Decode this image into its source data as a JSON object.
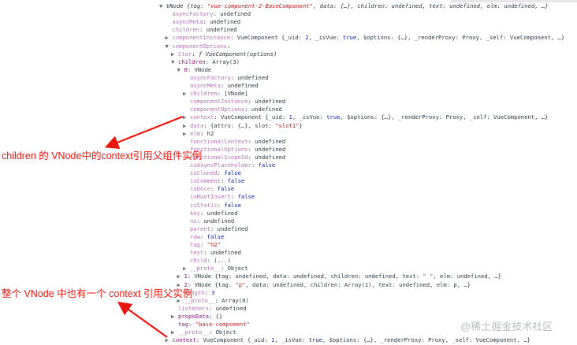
{
  "lines": [
    {
      "indent": 0,
      "arrow": "▼",
      "parts": [
        {
          "t": "VNode ",
          "c": "i"
        },
        {
          "t": "{tag: ",
          "c": "i"
        },
        {
          "t": "\"vue-component-2-BaseComponent\"",
          "c": "s i"
        },
        {
          "t": ", data: {…}, children: undefined, text: undefined, elm: undefined, …}",
          "c": "i"
        }
      ]
    },
    {
      "indent": 1,
      "arrow": "",
      "parts": [
        {
          "t": "asyncFactory",
          "c": "kd"
        },
        {
          "t": ": undefined",
          "c": ""
        }
      ]
    },
    {
      "indent": 1,
      "arrow": "",
      "parts": [
        {
          "t": "asyncMeta",
          "c": "kd"
        },
        {
          "t": ": undefined",
          "c": ""
        }
      ]
    },
    {
      "indent": 1,
      "arrow": "",
      "parts": [
        {
          "t": "children",
          "c": "kd"
        },
        {
          "t": ": undefined",
          "c": ""
        }
      ]
    },
    {
      "indent": 1,
      "arrow": "▶",
      "parts": [
        {
          "t": "componentInstance",
          "c": "kd"
        },
        {
          "t": ": VueComponent {_uid: ",
          "c": ""
        },
        {
          "t": "2",
          "c": "n"
        },
        {
          "t": ", _isVue: ",
          "c": ""
        },
        {
          "t": "true",
          "c": "kw"
        },
        {
          "t": ", $options: {…}, _renderProxy: Proxy, _self: VueComponent, …}",
          "c": ""
        }
      ]
    },
    {
      "indent": 1,
      "arrow": "▼",
      "parts": [
        {
          "t": "componentOptions",
          "c": "kd"
        },
        {
          "t": ":",
          "c": ""
        }
      ]
    },
    {
      "indent": 2,
      "arrow": "▶",
      "parts": [
        {
          "t": "Ctor",
          "c": "kd"
        },
        {
          "t": ": ",
          "c": ""
        },
        {
          "t": "ƒ VueComponent(options)",
          "c": "i"
        }
      ]
    },
    {
      "indent": 2,
      "arrow": "▼",
      "parts": [
        {
          "t": "children",
          "c": "k"
        },
        {
          "t": ": Array(3)",
          "c": ""
        }
      ]
    },
    {
      "indent": 3,
      "arrow": "▼",
      "parts": [
        {
          "t": "0",
          "c": "k"
        },
        {
          "t": ": VNode",
          "c": ""
        }
      ]
    },
    {
      "indent": 4,
      "arrow": "",
      "parts": [
        {
          "t": "asyncFactory",
          "c": "kd"
        },
        {
          "t": ": undefined",
          "c": ""
        }
      ]
    },
    {
      "indent": 4,
      "arrow": "",
      "parts": [
        {
          "t": "asyncMeta",
          "c": "kd"
        },
        {
          "t": ": undefined",
          "c": ""
        }
      ]
    },
    {
      "indent": 4,
      "arrow": "▶",
      "parts": [
        {
          "t": "children",
          "c": "kd"
        },
        {
          "t": ": [VNode]",
          "c": ""
        }
      ]
    },
    {
      "indent": 4,
      "arrow": "",
      "parts": [
        {
          "t": "componentInstance",
          "c": "kd"
        },
        {
          "t": ": undefined",
          "c": ""
        }
      ]
    },
    {
      "indent": 4,
      "arrow": "",
      "parts": [
        {
          "t": "componentOptions",
          "c": "kd"
        },
        {
          "t": ": undefined",
          "c": ""
        }
      ]
    },
    {
      "indent": 4,
      "arrow": "▶",
      "parts": [
        {
          "t": "context",
          "c": "kd"
        },
        {
          "t": ": VueComponent {_uid: ",
          "c": ""
        },
        {
          "t": "1",
          "c": "n"
        },
        {
          "t": ", _isVue: ",
          "c": ""
        },
        {
          "t": "true",
          "c": "kw"
        },
        {
          "t": ", $options: {…}, _renderProxy: Proxy, _self: VueComponent, …}",
          "c": ""
        }
      ]
    },
    {
      "indent": 4,
      "arrow": "▶",
      "parts": [
        {
          "t": "data",
          "c": "kd"
        },
        {
          "t": ": {attrs: {…}, slot: ",
          "c": ""
        },
        {
          "t": "\"slot1\"",
          "c": "s"
        },
        {
          "t": "}",
          "c": ""
        }
      ]
    },
    {
      "indent": 4,
      "arrow": "▶",
      "parts": [
        {
          "t": "elm",
          "c": "kd"
        },
        {
          "t": ": h2",
          "c": ""
        }
      ]
    },
    {
      "indent": 4,
      "arrow": "",
      "parts": [
        {
          "t": "functionalContext",
          "c": "kd"
        },
        {
          "t": ": undefined",
          "c": ""
        }
      ]
    },
    {
      "indent": 4,
      "arrow": "",
      "parts": [
        {
          "t": "functionalOptions",
          "c": "kd"
        },
        {
          "t": ": undefined",
          "c": ""
        }
      ]
    },
    {
      "indent": 4,
      "arrow": "",
      "parts": [
        {
          "t": "functionalScopeId",
          "c": "kd"
        },
        {
          "t": ": undefined",
          "c": ""
        }
      ]
    },
    {
      "indent": 4,
      "arrow": "",
      "parts": [
        {
          "t": "isAsyncPlaceholder",
          "c": "kd"
        },
        {
          "t": ": ",
          "c": ""
        },
        {
          "t": "false",
          "c": "kw"
        }
      ]
    },
    {
      "indent": 4,
      "arrow": "",
      "parts": [
        {
          "t": "isCloned",
          "c": "kd"
        },
        {
          "t": ": ",
          "c": ""
        },
        {
          "t": "false",
          "c": "kw"
        }
      ]
    },
    {
      "indent": 4,
      "arrow": "",
      "parts": [
        {
          "t": "isComment",
          "c": "kd"
        },
        {
          "t": ": ",
          "c": ""
        },
        {
          "t": "false",
          "c": "kw"
        }
      ]
    },
    {
      "indent": 4,
      "arrow": "",
      "parts": [
        {
          "t": "isOnce",
          "c": "kd"
        },
        {
          "t": ": ",
          "c": ""
        },
        {
          "t": "false",
          "c": "kw"
        }
      ]
    },
    {
      "indent": 4,
      "arrow": "",
      "parts": [
        {
          "t": "isRootInsert",
          "c": "kd"
        },
        {
          "t": ": ",
          "c": ""
        },
        {
          "t": "false",
          "c": "kw"
        }
      ]
    },
    {
      "indent": 4,
      "arrow": "",
      "parts": [
        {
          "t": "isStatic",
          "c": "kd"
        },
        {
          "t": ": ",
          "c": ""
        },
        {
          "t": "false",
          "c": "kw"
        }
      ]
    },
    {
      "indent": 4,
      "arrow": "",
      "parts": [
        {
          "t": "key",
          "c": "kd"
        },
        {
          "t": ": undefined",
          "c": ""
        }
      ]
    },
    {
      "indent": 4,
      "arrow": "",
      "parts": [
        {
          "t": "ns",
          "c": "kd"
        },
        {
          "t": ": undefined",
          "c": ""
        }
      ]
    },
    {
      "indent": 4,
      "arrow": "",
      "parts": [
        {
          "t": "parent",
          "c": "kd"
        },
        {
          "t": ": undefined",
          "c": ""
        }
      ]
    },
    {
      "indent": 4,
      "arrow": "",
      "parts": [
        {
          "t": "raw",
          "c": "kd"
        },
        {
          "t": ": ",
          "c": ""
        },
        {
          "t": "false",
          "c": "kw"
        }
      ]
    },
    {
      "indent": 4,
      "arrow": "",
      "parts": [
        {
          "t": "tag",
          "c": "kd"
        },
        {
          "t": ": ",
          "c": ""
        },
        {
          "t": "\"h2\"",
          "c": "s"
        }
      ]
    },
    {
      "indent": 4,
      "arrow": "",
      "parts": [
        {
          "t": "text",
          "c": "kd"
        },
        {
          "t": ": undefined",
          "c": ""
        }
      ]
    },
    {
      "indent": 4,
      "arrow": "",
      "parts": [
        {
          "t": "child",
          "c": "kd"
        },
        {
          "t": ": (...)",
          "c": ""
        }
      ]
    },
    {
      "indent": 4,
      "arrow": "▶",
      "parts": [
        {
          "t": "__proto__",
          "c": "kd"
        },
        {
          "t": ": Object",
          "c": ""
        }
      ]
    },
    {
      "indent": 3,
      "arrow": "▶",
      "parts": [
        {
          "t": "1",
          "c": "k"
        },
        {
          "t": ": VNode {tag: undefined, data: undefined, children: undefined, text: ",
          "c": ""
        },
        {
          "t": "\" \"",
          "c": "s"
        },
        {
          "t": ", elm: undefined, …}",
          "c": ""
        }
      ]
    },
    {
      "indent": 3,
      "arrow": "▶",
      "parts": [
        {
          "t": "2",
          "c": "k"
        },
        {
          "t": ": VNode {tag: ",
          "c": ""
        },
        {
          "t": "\"p\"",
          "c": "s"
        },
        {
          "t": ", data: undefined, children: Array(1), text: undefined, elm: p, …}",
          "c": ""
        }
      ]
    },
    {
      "indent": 3,
      "arrow": "",
      "parts": [
        {
          "t": "length",
          "c": "kd"
        },
        {
          "t": ": ",
          "c": ""
        },
        {
          "t": "3",
          "c": "n"
        }
      ]
    },
    {
      "indent": 3,
      "arrow": "▶",
      "parts": [
        {
          "t": "__proto__",
          "c": "kd"
        },
        {
          "t": ": Array(0)",
          "c": ""
        }
      ]
    },
    {
      "indent": 2,
      "arrow": "",
      "parts": [
        {
          "t": "listeners",
          "c": "kd"
        },
        {
          "t": ": undefined",
          "c": ""
        }
      ]
    },
    {
      "indent": 2,
      "arrow": "▶",
      "parts": [
        {
          "t": "propsData",
          "c": "k"
        },
        {
          "t": ": {}",
          "c": ""
        }
      ]
    },
    {
      "indent": 2,
      "arrow": "",
      "parts": [
        {
          "t": "tag",
          "c": "k"
        },
        {
          "t": ": ",
          "c": ""
        },
        {
          "t": "\"base-component\"",
          "c": "s"
        }
      ]
    },
    {
      "indent": 2,
      "arrow": "▶",
      "parts": [
        {
          "t": "__proto__",
          "c": "kd"
        },
        {
          "t": ": Object",
          "c": ""
        }
      ]
    },
    {
      "indent": 1,
      "arrow": "▶",
      "parts": [
        {
          "t": "context",
          "c": "k"
        },
        {
          "t": ": VueComponent {_uid: ",
          "c": ""
        },
        {
          "t": "1",
          "c": "n"
        },
        {
          "t": ", _isVue: ",
          "c": ""
        },
        {
          "t": "true",
          "c": "kw"
        },
        {
          "t": ", $options: {…}, _renderProxy: Proxy, _self: VueComponent, …}",
          "c": ""
        }
      ]
    }
  ],
  "annotations": {
    "first": "children 的 VNode中的context引用父组件实例",
    "second": "整个 VNode 中也有一个 context 引用父实例"
  },
  "watermark": "@稀土掘金技术社区",
  "colors": {
    "annotation": "#e8170e",
    "string": "#c41a16",
    "key": "#881280",
    "number": "#1a1aa6"
  }
}
